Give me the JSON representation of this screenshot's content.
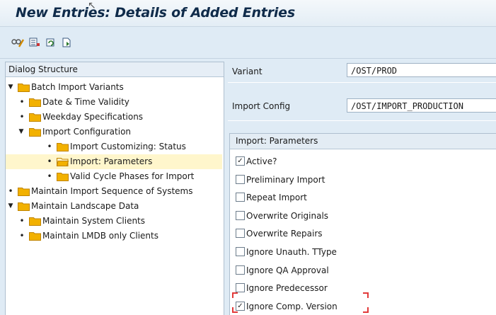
{
  "title": "New Entries: Details of Added Entries",
  "toolbar": {
    "icons": [
      "display-change-icon",
      "select-block-icon",
      "undo-icon",
      "next-entry-icon"
    ]
  },
  "dialog_structure": {
    "header": "Dialog Structure",
    "nodes": [
      {
        "label": "Batch Import Variants",
        "level": 0,
        "expander": "expanded",
        "selected": false
      },
      {
        "label": "Date & Time Validity",
        "level": 1,
        "expander": "leaf",
        "selected": false
      },
      {
        "label": "Weekday Specifications",
        "level": 1,
        "expander": "leaf",
        "selected": false
      },
      {
        "label": "Import Configuration",
        "level": 1,
        "expander": "expanded",
        "selected": false
      },
      {
        "label": "Import Customizing: Status",
        "level": 2,
        "expander": "leaf",
        "selected": false
      },
      {
        "label": "Import: Parameters",
        "level": 2,
        "expander": "leaf",
        "selected": true
      },
      {
        "label": "Valid Cycle Phases for Import",
        "level": 2,
        "expander": "leaf",
        "selected": false
      },
      {
        "label": "Maintain Import Sequence of Systems",
        "level": 0,
        "expander": "leaf",
        "selected": false
      },
      {
        "label": "Maintain Landscape Data",
        "level": 0,
        "expander": "expanded",
        "selected": false
      },
      {
        "label": "Maintain System Clients",
        "level": 1,
        "expander": "leaf",
        "selected": false
      },
      {
        "label": "Maintain LMDB only Clients",
        "level": 1,
        "expander": "leaf",
        "selected": false
      }
    ]
  },
  "fields": {
    "variant": {
      "label": "Variant",
      "value": "/OST/PROD"
    },
    "import_config": {
      "label": "Import Config",
      "value": "/OST/IMPORT_PRODUCTION"
    }
  },
  "parameters": {
    "header": "Import: Parameters",
    "options": [
      {
        "label": "Active?",
        "checked": true
      },
      {
        "label": "Preliminary Import",
        "checked": false
      },
      {
        "label": "Repeat Import",
        "checked": false
      },
      {
        "label": "Overwrite Originals",
        "checked": false
      },
      {
        "label": "Overwrite Repairs",
        "checked": false
      },
      {
        "label": "Ignore Unauth. TType",
        "checked": false
      },
      {
        "label": "Ignore QA Approval",
        "checked": false
      },
      {
        "label": "Ignore Predecessor",
        "checked": false
      },
      {
        "label": "Ignore Comp. Version",
        "checked": true
      }
    ]
  },
  "colors": {
    "folder": "#f2b100",
    "selection": "#fff6cc",
    "focus_marker": "#e23a3a",
    "background": "#dfebf5"
  }
}
